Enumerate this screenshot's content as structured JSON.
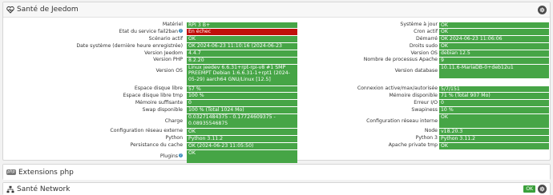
{
  "panel_health": {
    "title": "Santé de Jeedom",
    "rows": [
      {
        "l_label": "Matériel",
        "l_value": "RPI 3 B+",
        "r_label": "Système à jour",
        "r_value": "OK"
      },
      {
        "l_label": "Etat du service fail2ban",
        "l_value": "En échec",
        "l_status": "error",
        "l_help": true,
        "r_label": "Cron actif",
        "r_value": "OK"
      },
      {
        "l_label": "Scénario actif",
        "l_value": "OK",
        "r_label": "Démarré",
        "r_value": "OK 2024-06-23 11:06:06"
      },
      {
        "l_label": "Date système (dernière heure enregistrée)",
        "l_value": "OK 2024-06-23 11:10:16 (2024-06-23 10:54:03)",
        "r_label": "Droits sudo",
        "r_value": "OK"
      },
      {
        "l_label": "Version Jeedom",
        "l_value": "4.4.7",
        "r_label": "Version OS",
        "r_value": "debian 12.5"
      },
      {
        "l_label": "Version PHP",
        "l_value": "8.2.20",
        "r_label": "Nombre de processus Apache",
        "r_value": "9"
      },
      {
        "l_label": "Version OS",
        "l_value": "Linux jeedev 6.6.31+rpt-rpi-v8 #1 SMP PREEMPT Debian 1:6.6.31-1+rpt1 (2024-05-29) aarch64 GNU/Linux [12.5]",
        "l_lines": 3,
        "r_label": "Version database",
        "r_value": "10.11.6-MariaDB-0+deb12u1"
      },
      {
        "l_label": "Espace disque libre",
        "l_value": "57 %",
        "r_label": "Connexion active/max/autorisée",
        "r_value": "5/7/151"
      },
      {
        "l_label": "Espace disque libre tmp",
        "l_value": "100 %",
        "r_label": "Mémoire disponible",
        "r_value": "71 % (Total 907 Mo)"
      },
      {
        "l_label": "Mémoire suffisante",
        "l_value": "0",
        "r_label": "Erreur I/O",
        "r_value": "0"
      },
      {
        "l_label": "Swap disponible",
        "l_value": "100 % (Total 1024 Mo)",
        "r_label": "Swapiness",
        "r_value": "10 %"
      },
      {
        "l_label": "Charge",
        "l_value": "0.03271484375 - 0.17724609375 - 0.08935546875",
        "l_lines": 2,
        "r_label": "Configuration réseau interne",
        "r_value": "OK"
      },
      {
        "l_label": "Configuration réseau externe",
        "l_value": "OK",
        "r_label": "Node",
        "r_value": "v18.20.3"
      },
      {
        "l_label": "Python",
        "l_value": "Python 3.11.2",
        "r_label": "Python 3",
        "r_value": "Python 3.11.2"
      },
      {
        "l_label": "Persistance du cache",
        "l_value": "OK (2024-06-23 11:05:50)",
        "r_label": "Apache private tmp",
        "r_value": "OK"
      },
      {
        "l_label": "Plugins",
        "l_value": "OK",
        "l_help": true,
        "l_lines": 2
      }
    ]
  },
  "panel_php": {
    "title": "Extensions php",
    "logo_text": "php"
  },
  "panel_network": {
    "title": "Santé Network",
    "status_badge": "OK"
  },
  "colors": {
    "ok": "#46a546",
    "error": "#c0100b",
    "accent": "#3c8dbc"
  },
  "icons": {
    "health": "heart-pulse-icon",
    "network": "network-icon",
    "settings": "settings-icon",
    "help": "question-icon"
  }
}
